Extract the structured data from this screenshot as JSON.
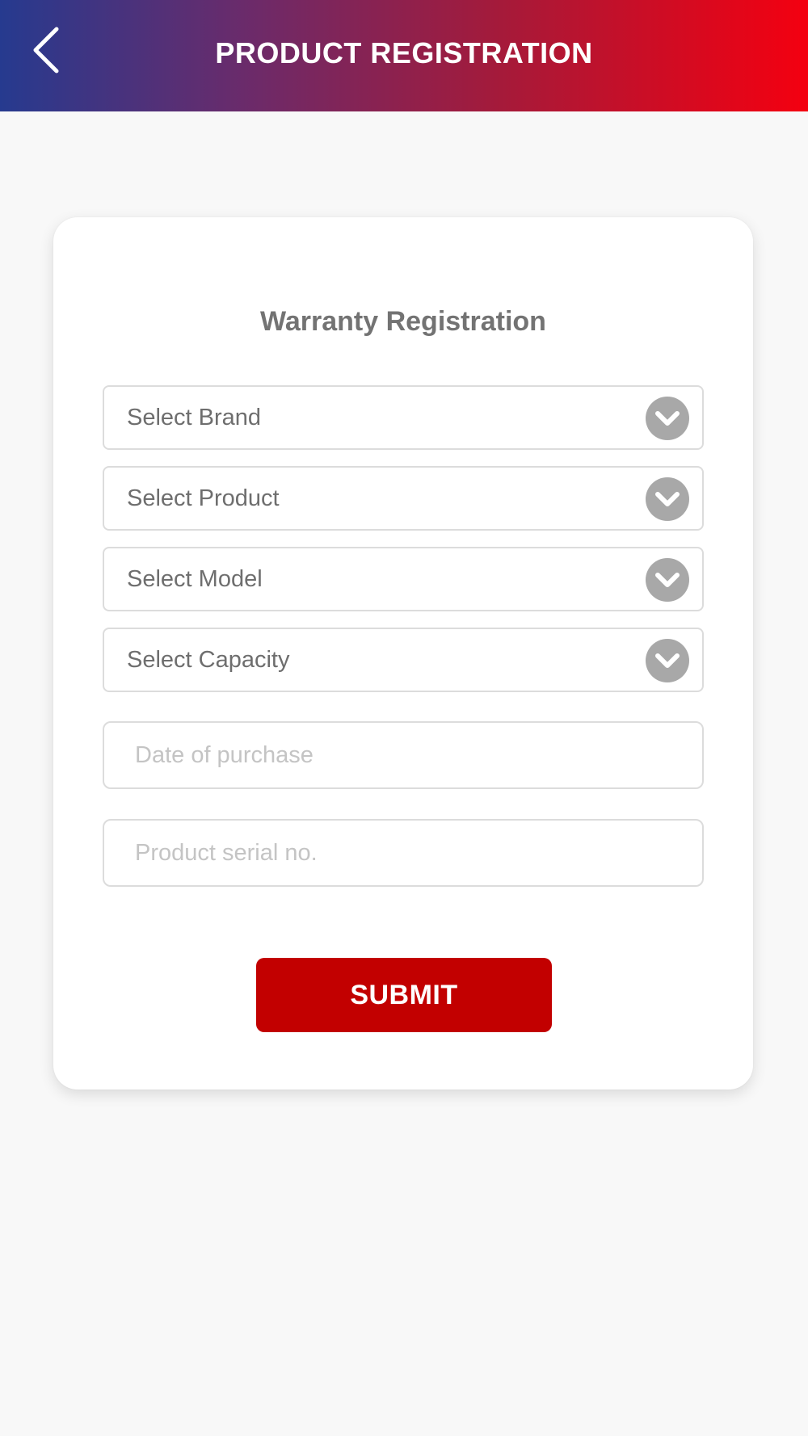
{
  "header": {
    "title": "PRODUCT REGISTRATION",
    "back_icon": "chevron-left-icon",
    "gradient": [
      "#263a8f",
      "#6a2b6b",
      "#a51a3a",
      "#f40010"
    ]
  },
  "form": {
    "title": "Warranty Registration",
    "selects": {
      "brand": "Select Brand",
      "product": "Select Product",
      "model": "Select Model",
      "capacity": "Select Capacity"
    },
    "dropdown_icon": "chevron-down-circle-icon",
    "inputs": {
      "date_placeholder": "Date of purchase",
      "serial_placeholder": "Product serial no."
    },
    "submit_label": "SUBMIT",
    "accent_color": "#c20000"
  }
}
